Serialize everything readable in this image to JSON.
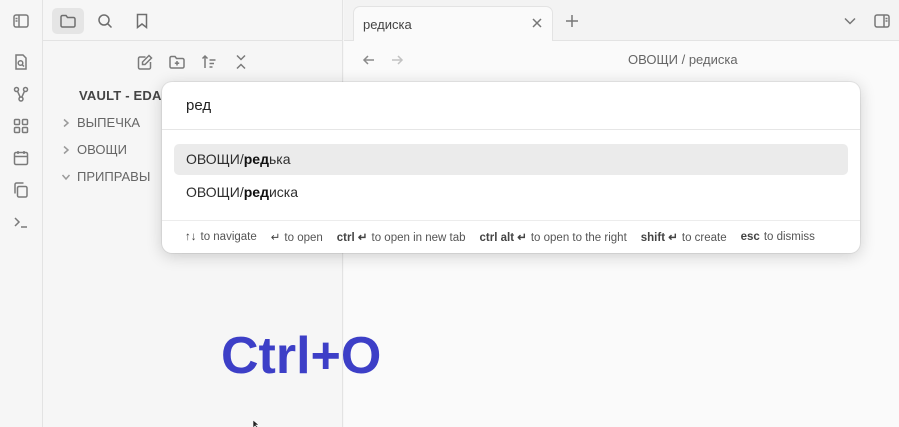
{
  "ribbon": {
    "icons": [
      "toggle-sidebar-icon",
      "file-search-icon",
      "graph-icon",
      "layout-grid-icon",
      "calendar-icon",
      "copy-icon",
      "terminal-icon"
    ]
  },
  "sidebar": {
    "vault_name": "VAULT - EDA",
    "folders": [
      {
        "name": "ВЫПЕЧКА",
        "expanded": false
      },
      {
        "name": "ОВОЩИ",
        "expanded": false
      },
      {
        "name": "ПРИПРАВЫ",
        "expanded": true
      }
    ]
  },
  "overlay_text": "Ctrl+O",
  "tab": {
    "title": "редиска"
  },
  "view_header": {
    "breadcrumb": "ОВОЩИ / редиска"
  },
  "prompt": {
    "query": "ред",
    "results": [
      {
        "prefix": "ОВОЩИ/",
        "match": "ред",
        "rest": "ька",
        "selected": true
      },
      {
        "prefix": "ОВОЩИ/",
        "match": "ред",
        "rest": "иска",
        "selected": false
      }
    ],
    "instructions": [
      {
        "key": "↑↓",
        "text": "to navigate"
      },
      {
        "key": "↵",
        "text": "to open"
      },
      {
        "key": "ctrl ↵",
        "text": "to open in new tab"
      },
      {
        "key": "ctrl alt ↵",
        "text": "to open to the right"
      },
      {
        "key": "shift ↵",
        "text": "to create"
      },
      {
        "key": "esc",
        "text": "to dismiss"
      }
    ]
  },
  "colors": {
    "accent_text": "#3d3fc7",
    "selected_row": "#ebebeb"
  }
}
